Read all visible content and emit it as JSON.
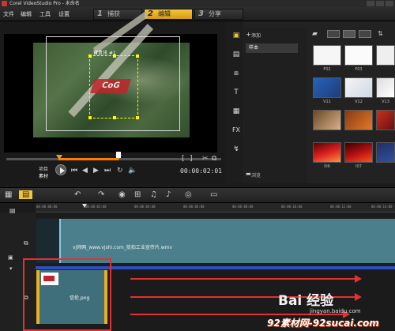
{
  "window": {
    "title": "Corel VideoStudio Pro - 未命名"
  },
  "menu": {
    "items": [
      "文件",
      "编辑",
      "工具",
      "设置"
    ]
  },
  "steps": [
    {
      "num": "1",
      "label": "捕获"
    },
    {
      "num": "2",
      "label": "编辑"
    },
    {
      "num": "3",
      "label": "分享"
    }
  ],
  "preview": {
    "caption": "寶贵讯 #1",
    "overlay_logo_text": "CoG",
    "mode_top": "项目",
    "mode_bottom": "素材",
    "timecode": "00:00:02:01"
  },
  "library": {
    "add_label": "添加",
    "folder": "样本",
    "browse_label": "浏览",
    "thumbs": [
      "F02",
      "F03",
      "",
      "V11",
      "V12",
      "V13",
      "",
      "",
      "",
      "I06",
      "I07",
      ""
    ]
  },
  "timeline": {
    "ticks": [
      "00:00:00:00",
      "00:00:02:00",
      "00:00:04:00",
      "00:00:06:00",
      "00:00:08:00",
      "00:00:10:00",
      "00:00:12:00",
      "00:00:14:00"
    ],
    "video_clip": "vj师网_www.vjshi.com_航拍工业宣传片.wmv",
    "overlay_clip": "信伦.png"
  },
  "watermark": {
    "baidu": "Bai 经验",
    "url": "jingyan.baidu.com",
    "footer": "92素材网-92sucai.com"
  },
  "colors": {
    "accent": "#f3c53a",
    "video_clip": "#4c7f8c",
    "highlight": "#e53030",
    "track_line": "#2e4fc1"
  }
}
